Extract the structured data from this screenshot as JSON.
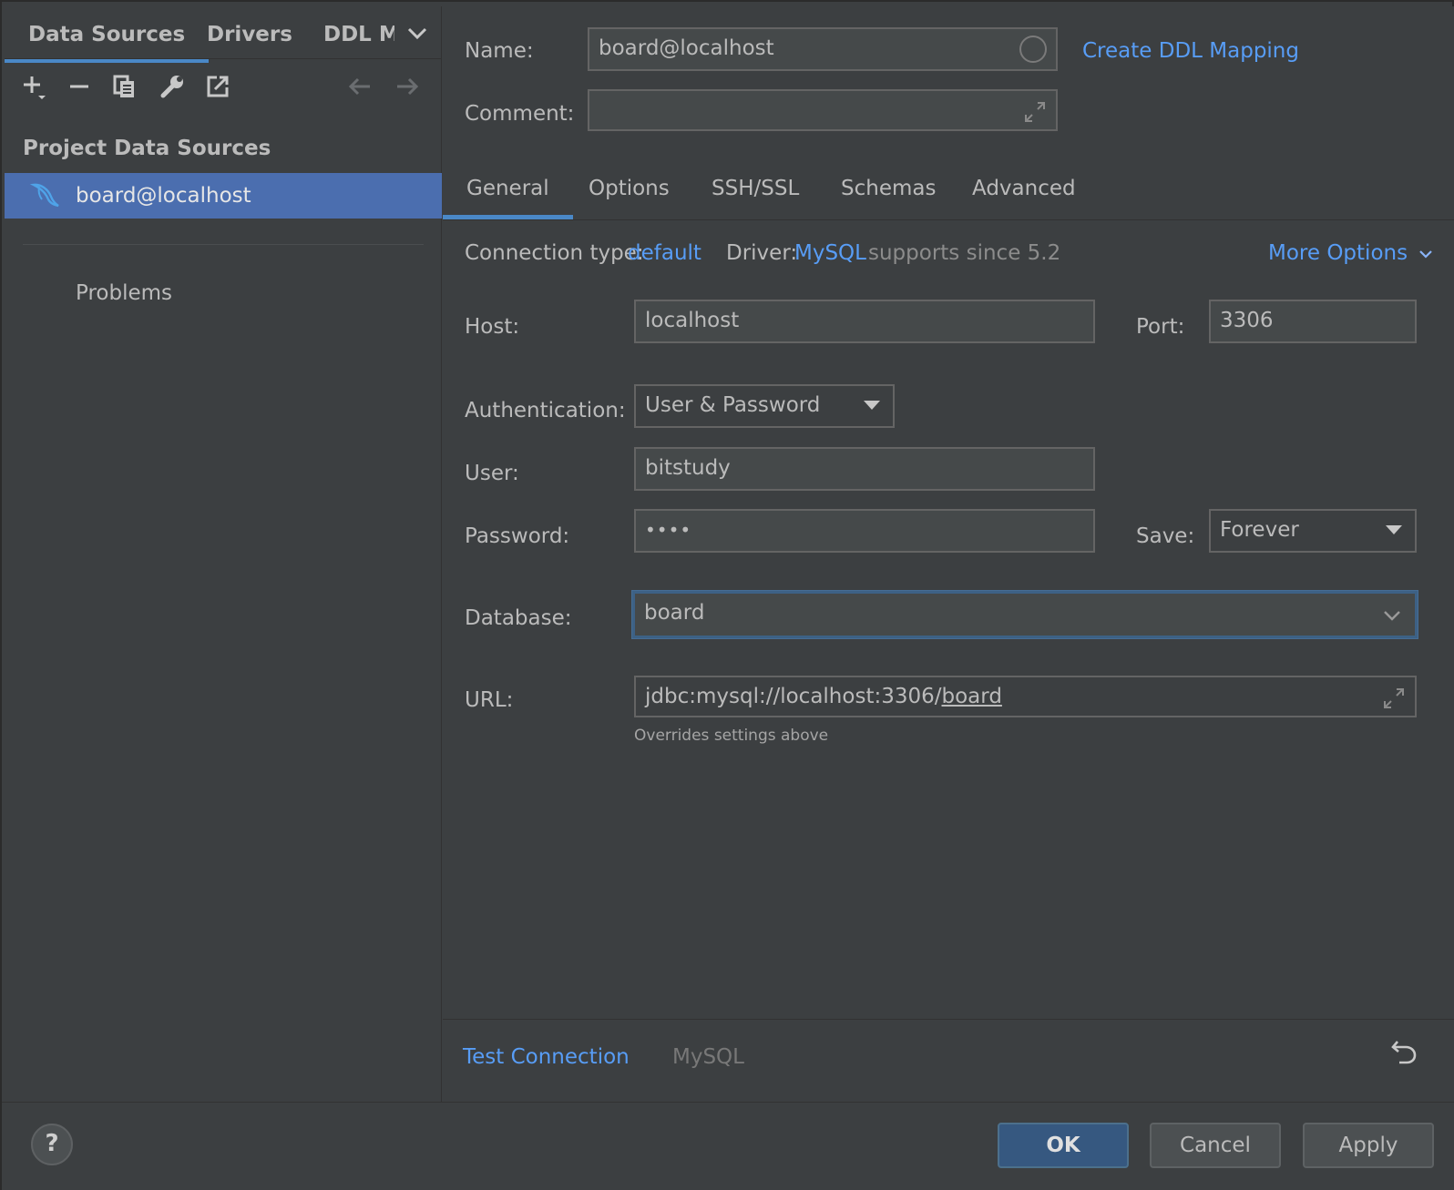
{
  "left": {
    "tabs": [
      "Data Sources",
      "Drivers",
      "DDL M"
    ],
    "section_title": "Project Data Sources",
    "data_source": "board@localhost",
    "problems": "Problems"
  },
  "form": {
    "name_label": "Name:",
    "name_value": "board@localhost",
    "create_ddl": "Create DDL Mapping",
    "comment_label": "Comment:",
    "comment_value": "",
    "tabs": [
      "General",
      "Options",
      "SSH/SSL",
      "Schemas",
      "Advanced"
    ],
    "conn_type_label": "Connection type:",
    "conn_type_value": "default",
    "driver_label": "Driver:",
    "driver_value": "MySQL",
    "driver_note": "supports since 5.2",
    "more_options": "More Options",
    "host_label": "Host:",
    "host_value": "localhost",
    "port_label": "Port:",
    "port_value": "3306",
    "auth_label": "Authentication:",
    "auth_value": "User & Password",
    "user_label": "User:",
    "user_value": "bitstudy",
    "password_label": "Password:",
    "password_value": "••••",
    "save_label": "Save:",
    "save_value": "Forever",
    "database_label": "Database:",
    "database_value": "board",
    "url_label": "URL:",
    "url_prefix": "jdbc:mysql://localhost:3306/",
    "url_db": "board",
    "url_hint": "Overrides settings above",
    "test_connection": "Test Connection",
    "driver_footer": "MySQL"
  },
  "footer": {
    "help": "?",
    "ok": "OK",
    "cancel": "Cancel",
    "apply": "Apply"
  },
  "colors": {
    "accent": "#4a88c7",
    "link": "#589df6",
    "selection": "#4b6eaf",
    "background": "#3c3f41"
  }
}
